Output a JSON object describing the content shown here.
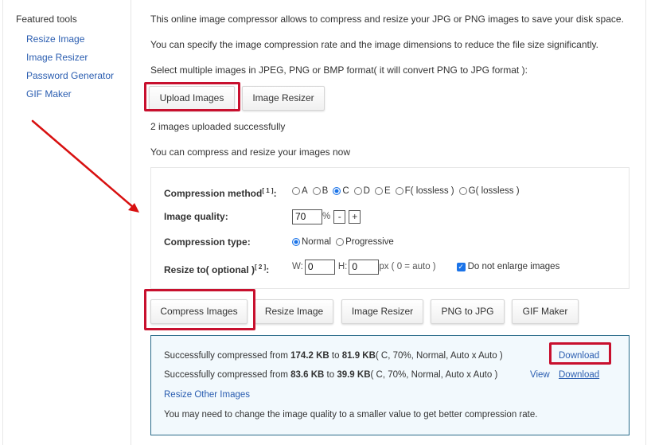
{
  "sidebar": {
    "title": "Featured tools",
    "items": [
      {
        "label": "Resize Image"
      },
      {
        "label": "Image Resizer"
      },
      {
        "label": "Password Generator"
      },
      {
        "label": "GIF Maker"
      }
    ]
  },
  "intro": {
    "line1": "This online image compressor allows to compress and resize your JPG or PNG images to save your disk space.",
    "line2": "You can specify the image compression rate and the image dimensions to reduce the file size significantly.",
    "line3": "Select multiple images in JPEG, PNG or BMP format( it will convert PNG to JPG format ):"
  },
  "upload_buttons": {
    "upload": "Upload Images",
    "resizer": "Image Resizer"
  },
  "status": {
    "uploaded": "2 images uploaded successfully",
    "ready": "You can compress and resize your images now"
  },
  "form": {
    "method_label": "Compression method",
    "method_note": "[ 1 ]",
    "colon": ":",
    "methods": [
      "A",
      "B",
      "C",
      "D",
      "E",
      "F( lossless )",
      "G( lossless )"
    ],
    "method_selected": "C",
    "quality_label": "Image quality:",
    "quality_value": "70",
    "percent": "%",
    "minus": "-",
    "plus": "+",
    "type_label": "Compression type:",
    "types": [
      "Normal",
      "Progressive"
    ],
    "type_selected": "Normal",
    "resize_label": "Resize to( optional )",
    "resize_note": "[ 2 ]",
    "w_label": "W:",
    "w_value": "0",
    "h_label": "H:",
    "h_value": "0",
    "px_note": "px ( 0 = auto )",
    "no_enlarge_label": "Do not enlarge images",
    "no_enlarge_checked": true
  },
  "action_buttons": {
    "compress": "Compress Images",
    "resize": "Resize Image",
    "resizer": "Image Resizer",
    "png_to_jpg": "PNG to JPG",
    "gif_maker": "GIF Maker"
  },
  "results": {
    "items": [
      {
        "prefix": "Successfully compressed from ",
        "from": "174.2 KB",
        "to_word": " to ",
        "to": "81.9 KB",
        "details": "( C, 70%, Normal, Auto x Auto )",
        "view": "",
        "download": "Download"
      },
      {
        "prefix": "Successfully compressed from ",
        "from": "83.6 KB",
        "to_word": " to ",
        "to": "39.9 KB",
        "details": "( C, 70%, Normal, Auto x Auto )",
        "view": "View",
        "download": "Download"
      }
    ],
    "resize_other": "Resize Other Images",
    "tip": "You may need to change the image quality to a smaller value to get better compression rate."
  },
  "colors": {
    "highlight": "#c8102e",
    "link": "#2a5db0",
    "result_border": "#2a6b8a",
    "result_bg": "#f2f9fd"
  }
}
